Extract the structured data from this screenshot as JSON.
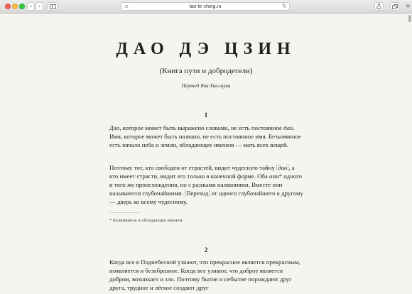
{
  "browser": {
    "url": "tao-te-ching.ru",
    "reader_icon": "reader-icon",
    "reload_icon": "reload-icon",
    "new_tab_label": "+"
  },
  "book": {
    "title": "ДАО ДЭ ЦЗИН",
    "subtitle": "(Книга пути и добродетели)",
    "translator": "Перевод Яна Хин-шуна"
  },
  "chapters": [
    {
      "number": "1",
      "paragraphs": [
        {
          "parts": [
            {
              "text": "Дао",
              "style": "italic"
            },
            {
              "text": ", которое может быть выражено словами, не есть постоянное "
            },
            {
              "text": "дао",
              "style": "italic"
            },
            {
              "text": ". Имя, которое может быть названо, не есть постоянное имя. Безымянное есть начало неба и земли, обладающее именем — мать всех вещей."
            }
          ]
        },
        {
          "parts": [
            {
              "text": "Поэтому тот, кто свободен от страстей, видит чудесную тайну "
            },
            {
              "text": "дао",
              "style": "marked-italic"
            },
            {
              "text": ", а кто имеет страсти, видит его только в конечной форме. Оба они* одного и того же происхождения, но с разными названиями. Вместе они называются глубочайшими. "
            },
            {
              "text": "Переход",
              "style": "marked"
            },
            {
              "text": " от одного глубочайшего к другому — дверь ко всему чудесному."
            }
          ]
        }
      ],
      "footnote": "* Безымянное и обладающее именем."
    },
    {
      "number": "2",
      "paragraphs": [
        {
          "parts": [
            {
              "text": "Когда все в Поднебесной узнают, что прекрасное является прекрасным, появляется и безобразное. Когда все узнают, что доброе является добром, возникает и зло. Поэтому бытие и небытие порождают друг друга, трудное и лёгкое создают друг"
            }
          ]
        }
      ]
    }
  ]
}
